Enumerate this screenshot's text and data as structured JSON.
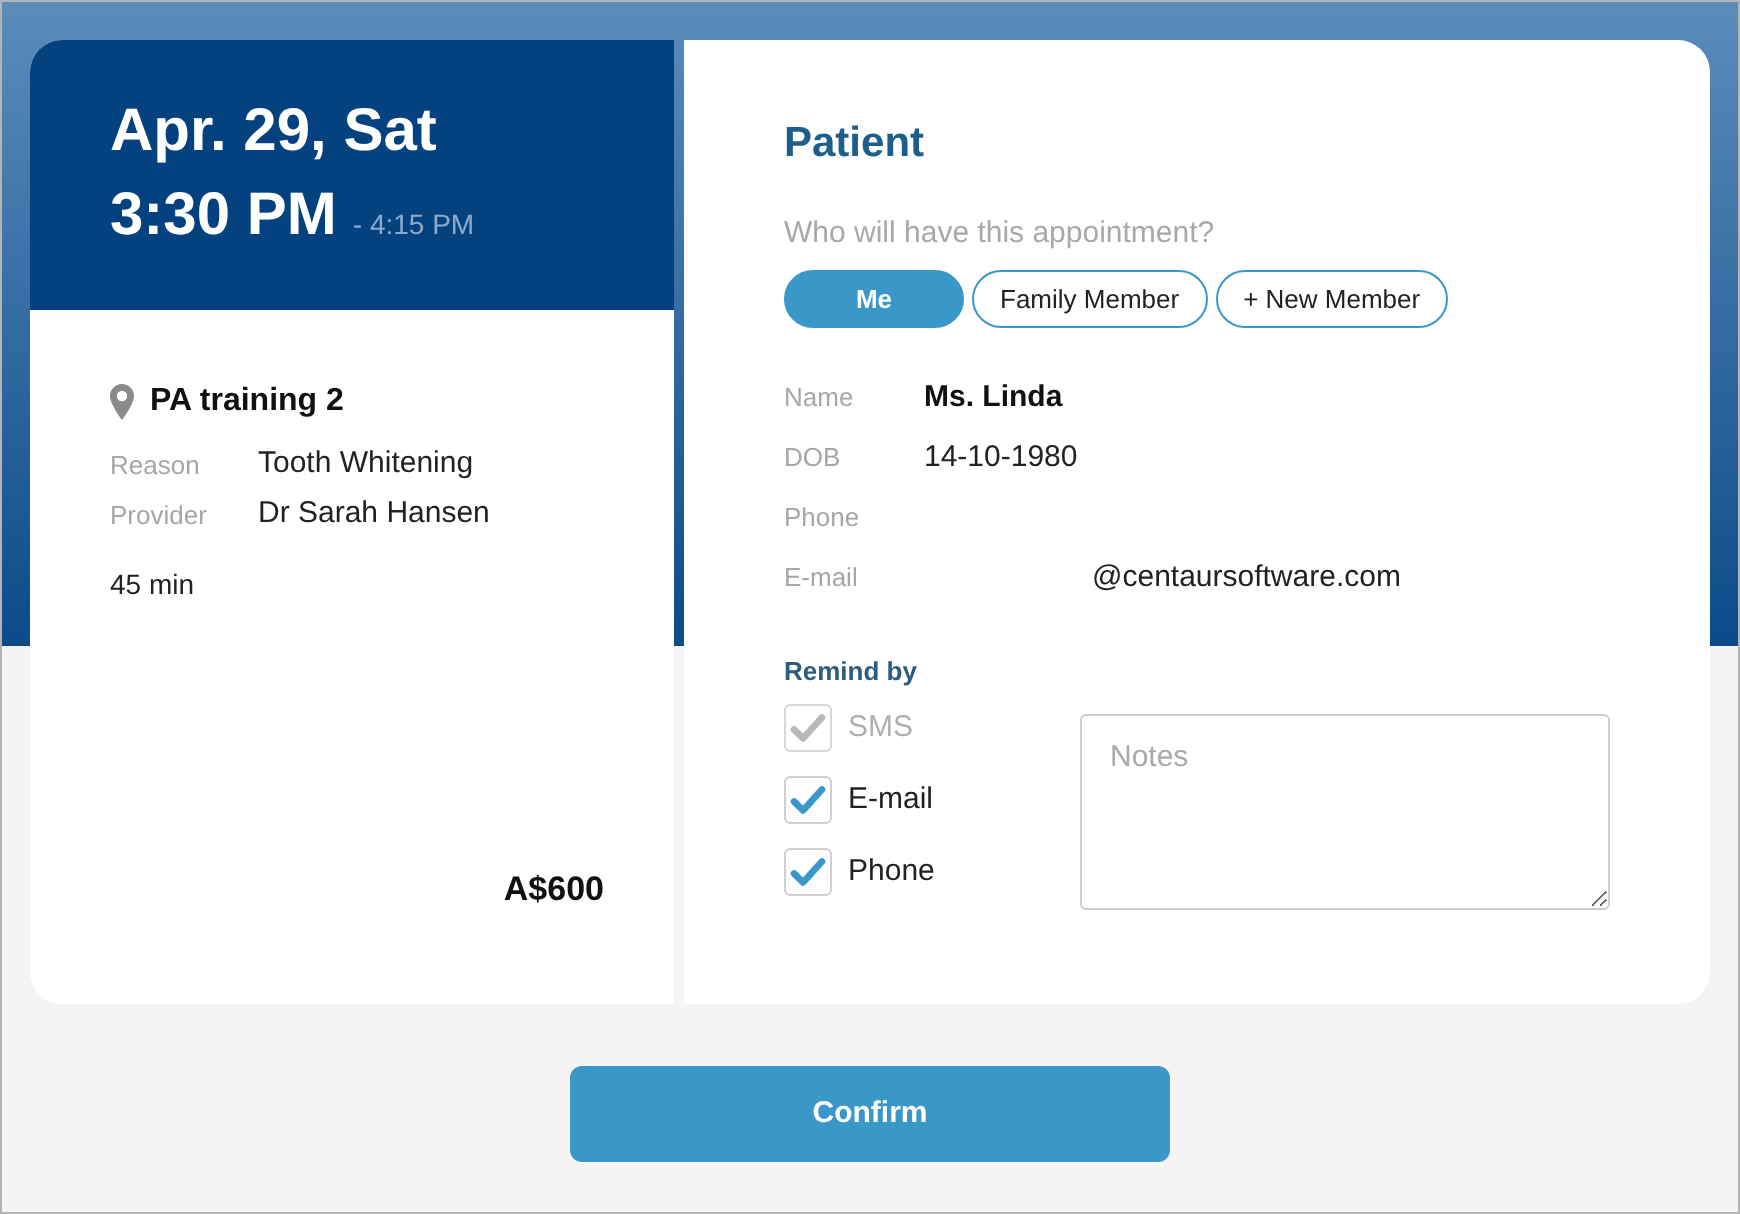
{
  "appointment": {
    "date": "Apr. 29, Sat",
    "start_time": "3:30 PM",
    "end_time": "- 4:15 PM",
    "location": "PA training 2",
    "details": [
      {
        "label": "Reason",
        "value": "Tooth Whitening"
      },
      {
        "label": "Provider",
        "value": "Dr Sarah Hansen"
      }
    ],
    "duration": "45 min",
    "price": "A$600"
  },
  "patient": {
    "title": "Patient",
    "question": "Who will have this appointment?",
    "choices": [
      {
        "label": "Me",
        "selected": true
      },
      {
        "label": "Family Member",
        "selected": false
      },
      {
        "label": "+ New Member",
        "selected": false
      }
    ],
    "fields": [
      {
        "label": "Name",
        "value": "Ms. Linda",
        "kind": "name"
      },
      {
        "label": "DOB",
        "value": "14-10-1980",
        "kind": "text"
      },
      {
        "label": "Phone",
        "kind": "text"
      },
      {
        "label": "E-mail",
        "value": "@centaursoftware.com",
        "kind": "email"
      }
    ]
  },
  "remind": {
    "label": "Remind by",
    "options": [
      {
        "label": "SMS",
        "checked": true,
        "disabled": true
      },
      {
        "label": "E-mail",
        "checked": true,
        "disabled": false
      },
      {
        "label": "Phone",
        "checked": true,
        "disabled": false
      }
    ]
  },
  "notes": {
    "placeholder": "Notes"
  },
  "confirm_button": "Confirm"
}
